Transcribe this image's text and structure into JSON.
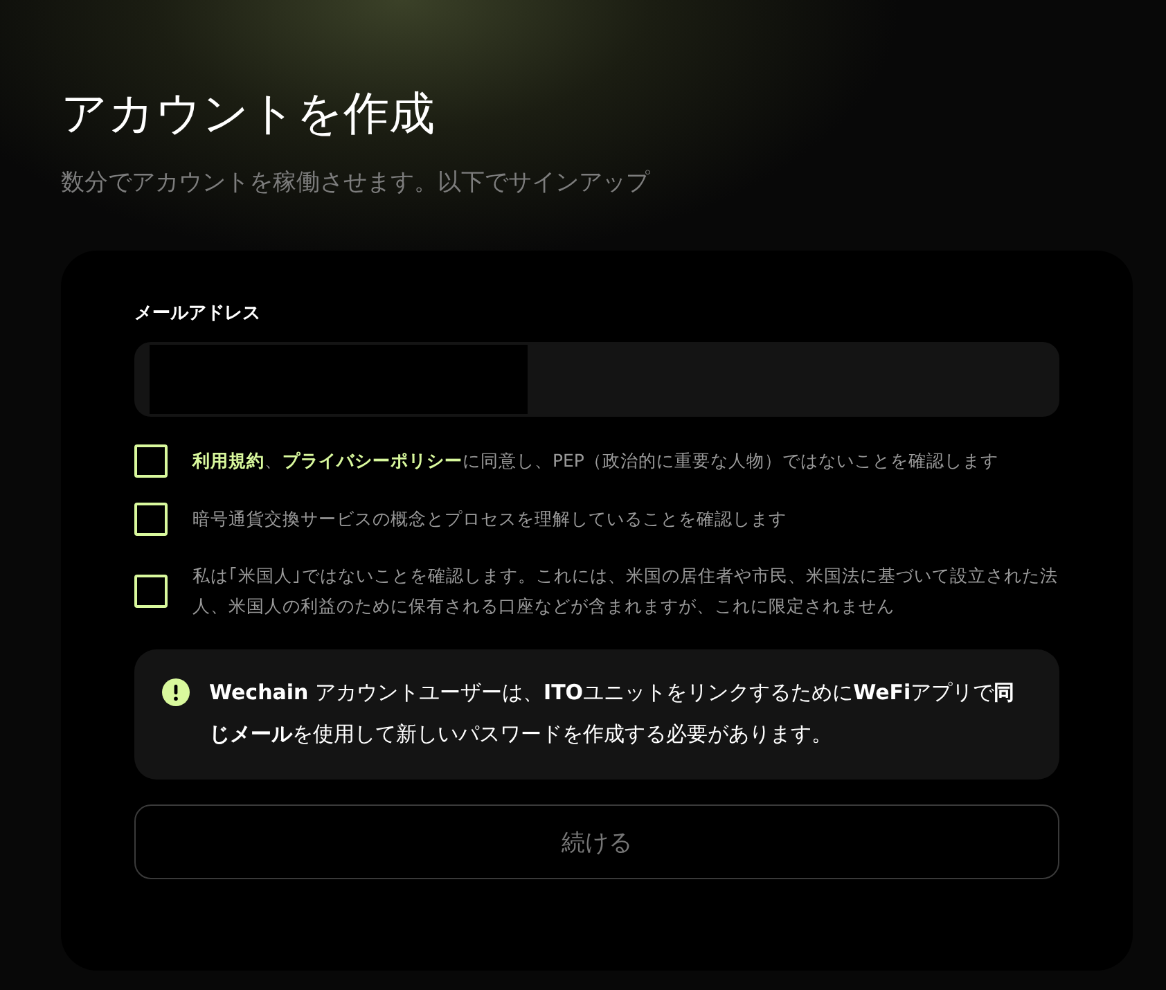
{
  "header": {
    "title": "アカウントを作成",
    "subtitle": "数分でアカウントを稼働させます。以下でサインアップ"
  },
  "form": {
    "email_label": "メールアドレス",
    "consents": [
      {
        "checked": false,
        "parts": [
          {
            "kind": "link",
            "text": "利用規約"
          },
          {
            "kind": "text",
            "text": "、"
          },
          {
            "kind": "link",
            "text": "プライバシーポリシー"
          },
          {
            "kind": "text",
            "text": "に同意し、PEP（政治的に重要な人物）ではないことを確認します"
          }
        ]
      },
      {
        "checked": false,
        "parts": [
          {
            "kind": "text",
            "text": "暗号通貨交換サービスの概念とプロセスを理解していることを確認します"
          }
        ]
      },
      {
        "checked": false,
        "parts": [
          {
            "kind": "text",
            "text": "私は｢米国人｣ではないことを確認します。これには、米国の居住者や市民、米国法に基づいて設立された法人、米国人の利益のために保有される口座などが含まれますが、これに限定されません"
          }
        ]
      }
    ],
    "notice": "**Wechain** アカウントユーザーは、**ITO**ユニットをリンクするために**WeFi**アプリで**同じメール**を使用して新しいパスワードを作成する必要があります。",
    "continue_button": {
      "label": "続ける",
      "disabled": true
    }
  }
}
